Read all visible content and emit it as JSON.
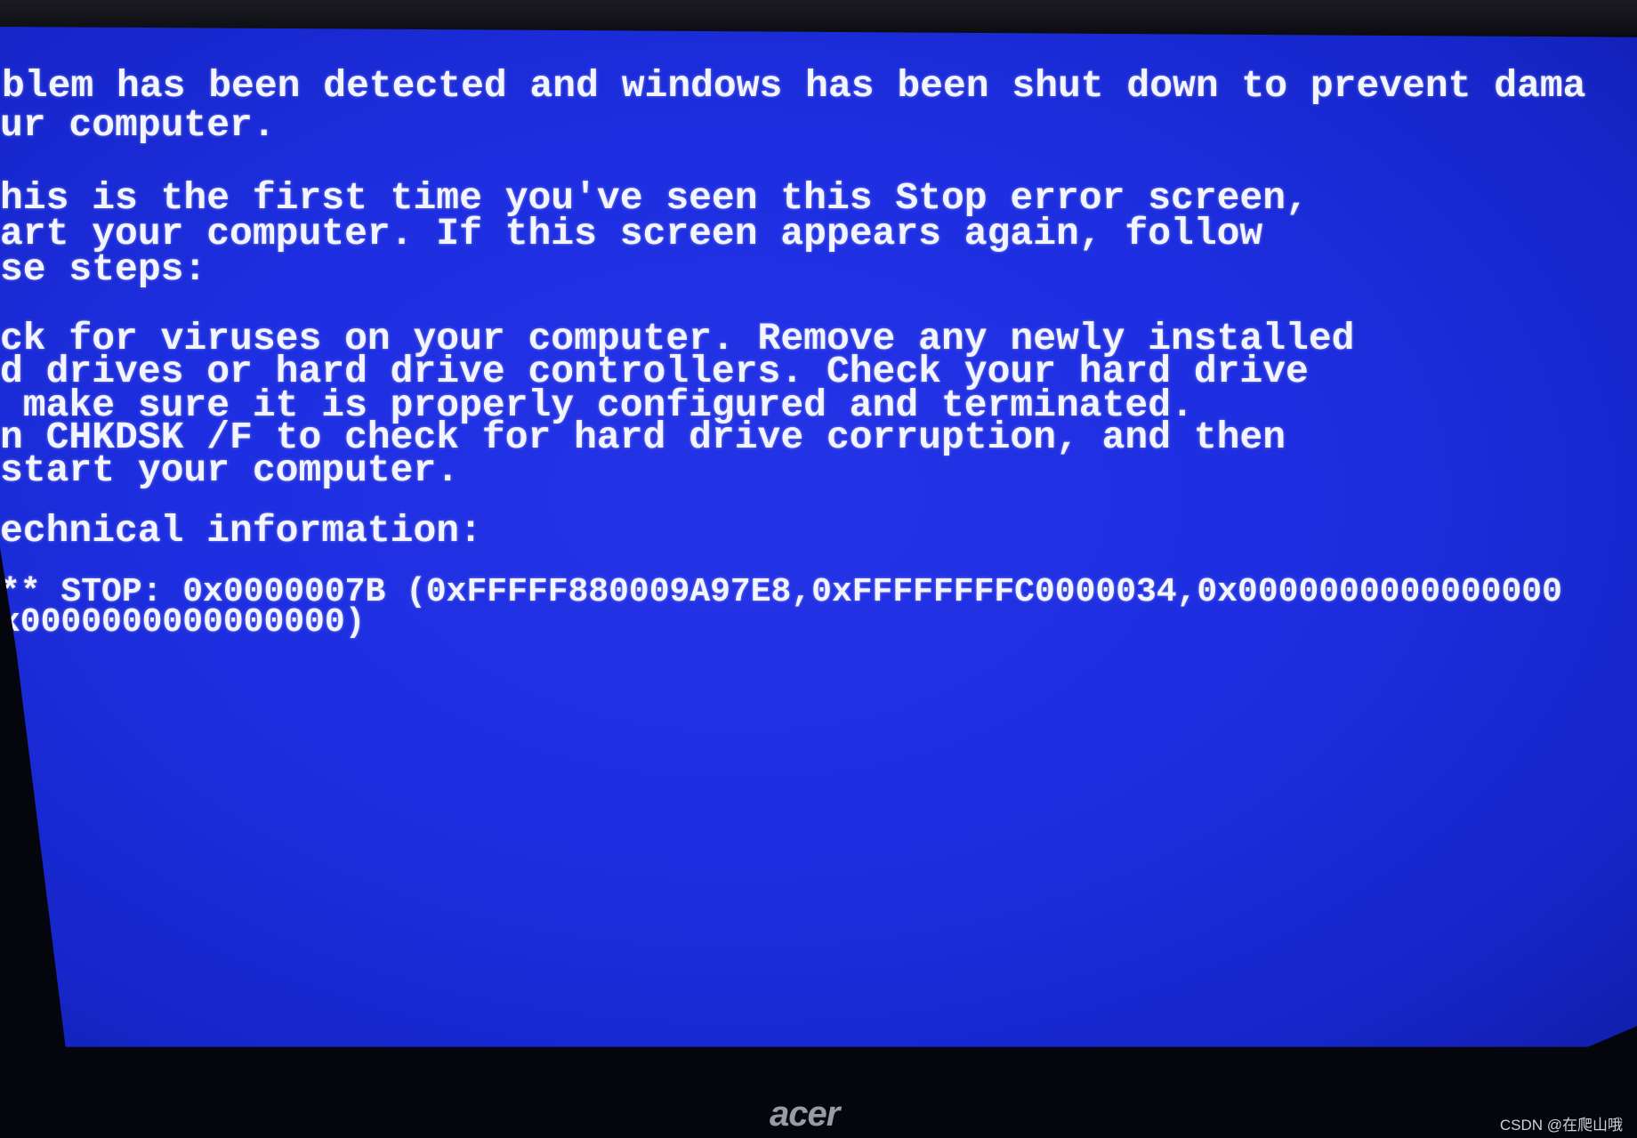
{
  "bsod": {
    "lines": [
      "blem has been detected and windows has been shut down to prevent dama",
      "ur computer.",
      "his is the first time you've seen this Stop error screen,",
      "art your computer. If this screen appears again, follow",
      "se steps:",
      "ck for viruses on your computer. Remove any newly installed",
      "d drives or hard drive controllers. Check your hard drive",
      " make sure it is properly configured and terminated.",
      "n CHKDSK /F to check for hard drive corruption, and then",
      "start your computer.",
      "echnical information:",
      "** STOP: 0x0000007B (0xFFFFF880009A97E8,0xFFFFFFFFC0000034,0x0000000000000000",
      "x0000000000000000)"
    ],
    "background_color": "#1d2ee0",
    "text_color": "#f2f4ff"
  },
  "monitor": {
    "brand_logo": "acer"
  },
  "watermark": "CSDN @在爬山哦"
}
